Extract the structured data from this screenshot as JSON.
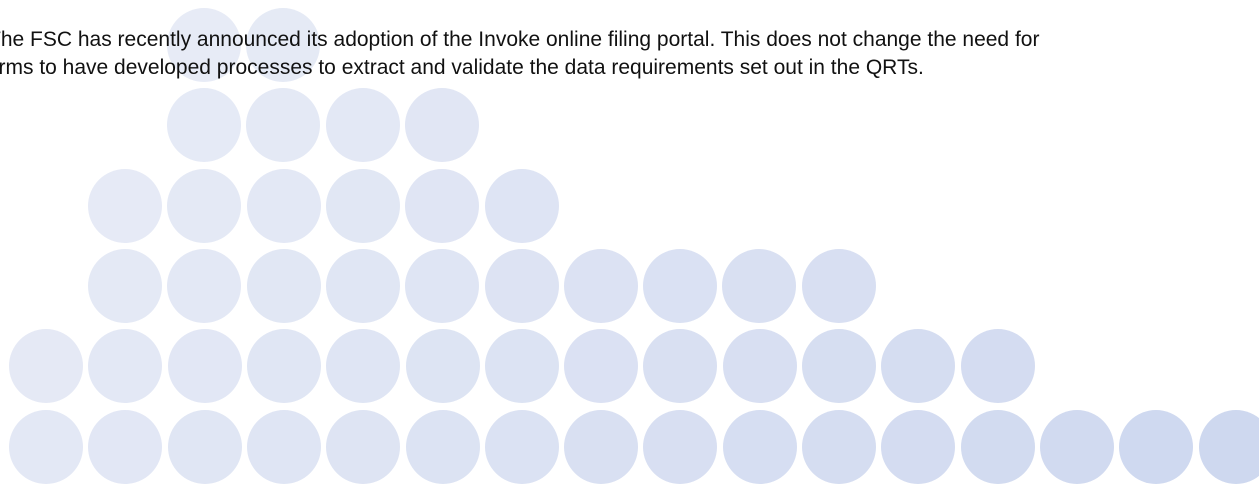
{
  "body": {
    "lines": [
      "The FSC has recently announced its adoption of the Invoke online filing portal.  This does not change the need for",
      "firms to have developed processes to extract and validate the data requirements set out in the QRTs."
    ]
  },
  "decoration": {
    "dot_counts_per_row": [
      2,
      4,
      6,
      10,
      13,
      16
    ],
    "colors": {
      "light": "#ebeef7",
      "dark": "#cdd7ef"
    }
  }
}
